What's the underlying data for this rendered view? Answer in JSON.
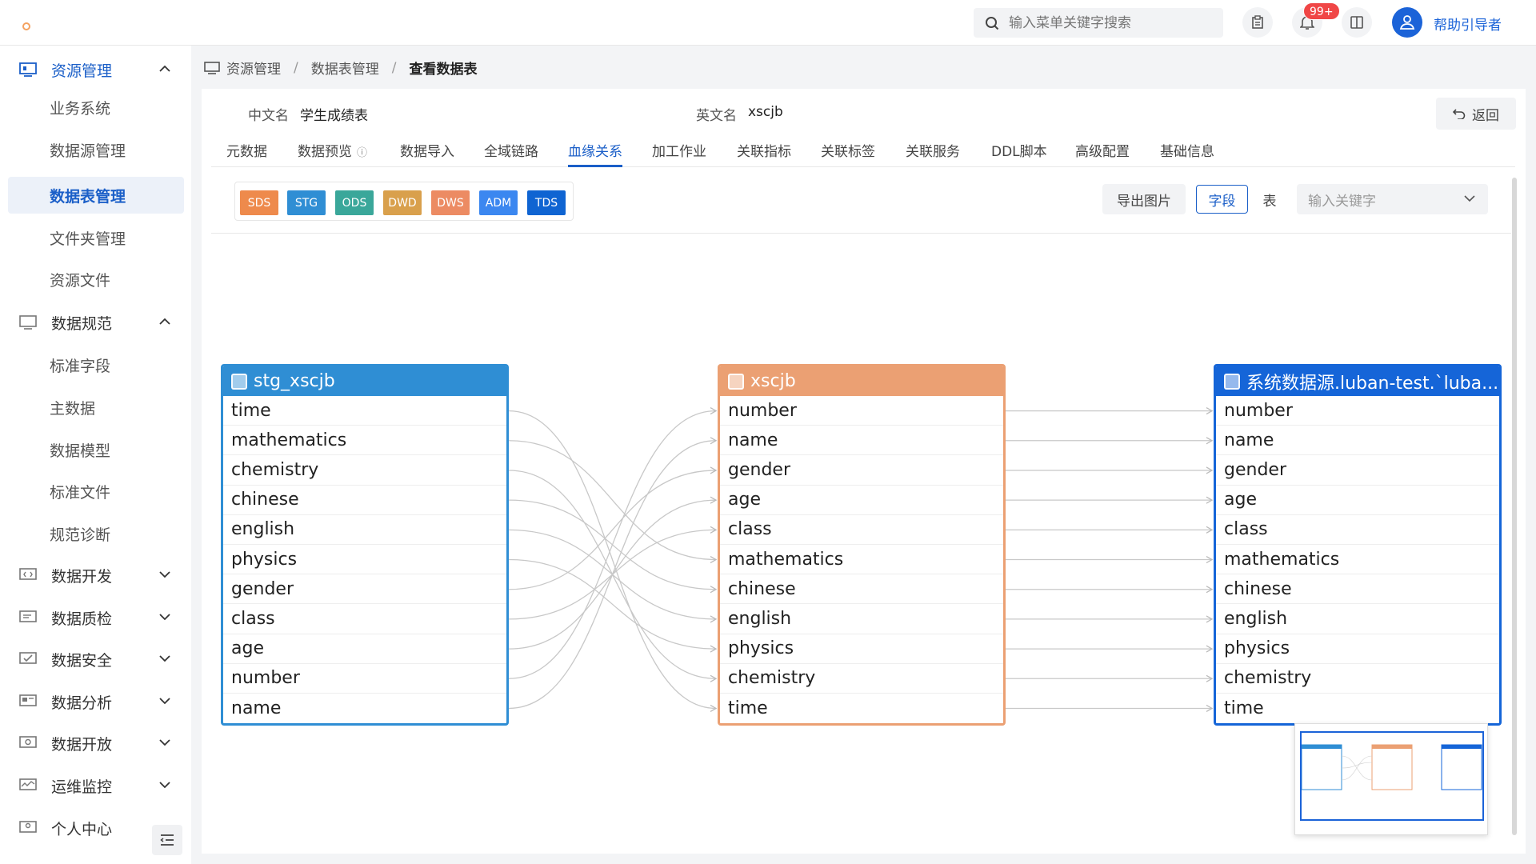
{
  "header": {
    "search_placeholder": "输入菜单关键字搜索",
    "notification_badge": "99+",
    "help_label": "帮助引导者",
    "icons": [
      "search-icon",
      "clipboard-icon",
      "bell-icon",
      "book-icon",
      "user-icon"
    ]
  },
  "sidebar": {
    "groups": [
      {
        "label": "资源管理",
        "icon": "monitor-icon",
        "expanded": true,
        "active": true
      },
      {
        "label": "数据规范",
        "icon": "monitor-icon",
        "expanded": true
      },
      {
        "label": "数据开发",
        "icon": "code-icon",
        "expanded": false
      },
      {
        "label": "数据质检",
        "icon": "monitor-icon",
        "expanded": false
      },
      {
        "label": "数据安全",
        "icon": "shield-icon",
        "expanded": false
      },
      {
        "label": "数据分析",
        "icon": "chart-icon",
        "expanded": false
      },
      {
        "label": "数据开放",
        "icon": "open-icon",
        "expanded": false
      },
      {
        "label": "运维监控",
        "icon": "pulse-icon",
        "expanded": false
      },
      {
        "label": "个人中心",
        "icon": "user-icon",
        "expanded": false
      }
    ],
    "resource_items": [
      "业务系统",
      "数据源管理",
      "数据表管理",
      "文件夹管理",
      "资源文件"
    ],
    "standard_items": [
      "标准字段",
      "主数据",
      "数据模型",
      "标准文件",
      "规范诊断"
    ],
    "active_item": "数据表管理"
  },
  "breadcrumb": [
    "资源管理",
    "数据表管理",
    "查看数据表"
  ],
  "meta": {
    "cn_label": "中文名",
    "cn_value": "学生成绩表",
    "en_label": "英文名",
    "en_value": "xscjb",
    "back_label": "返回"
  },
  "tabs": [
    "元数据",
    "数据预览",
    "数据导入",
    "全域链路",
    "血缘关系",
    "加工作业",
    "关联指标",
    "关联标签",
    "关联服务",
    "DDL脚本",
    "高级配置",
    "基础信息"
  ],
  "active_tab": "血缘关系",
  "layers": [
    {
      "label": "SDS",
      "color": "#ee8a4c"
    },
    {
      "label": "STG",
      "color": "#2f8ed4"
    },
    {
      "label": "ODS",
      "color": "#3aa79a"
    },
    {
      "label": "DWD",
      "color": "#d9a04c"
    },
    {
      "label": "DWS",
      "color": "#ec8b63"
    },
    {
      "label": "ADM",
      "color": "#3b87f0"
    },
    {
      "label": "TDS",
      "color": "#0f64d2"
    }
  ],
  "toolbar": {
    "export_label": "导出图片",
    "field_label": "字段",
    "table_label": "表",
    "keyword_placeholder": "输入关键字"
  },
  "lineage": {
    "source": {
      "title": "stg_xscjb",
      "color": "#2f8ed4",
      "fields": [
        "time",
        "mathematics",
        "chemistry",
        "chinese",
        "english",
        "physics",
        "gender",
        "class",
        "age",
        "number",
        "name"
      ]
    },
    "current": {
      "title": "xscjb",
      "color": "#eba073",
      "fields": [
        "number",
        "name",
        "gender",
        "age",
        "class",
        "mathematics",
        "chinese",
        "english",
        "physics",
        "chemistry",
        "time"
      ]
    },
    "target": {
      "title": "系统数据源.luban-test.`luba...",
      "color": "#1565d8",
      "fields": [
        "number",
        "name",
        "gender",
        "age",
        "class",
        "mathematics",
        "chinese",
        "english",
        "physics",
        "chemistry",
        "time"
      ]
    }
  }
}
